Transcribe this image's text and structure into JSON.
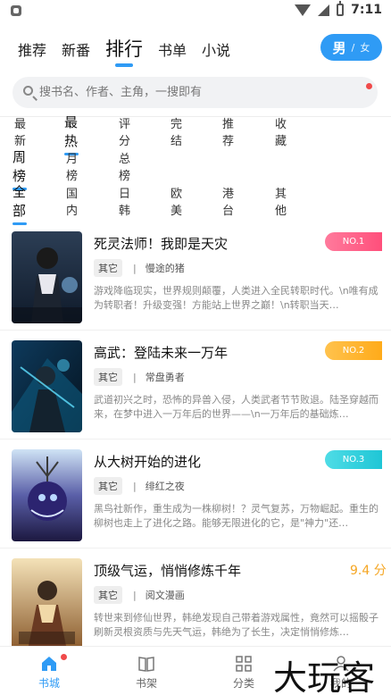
{
  "status_bar": {
    "time": "7:11"
  },
  "top_tabs": [
    {
      "label": "推荐",
      "active": false
    },
    {
      "label": "新番",
      "active": false
    },
    {
      "label": "排行",
      "active": true
    },
    {
      "label": "书单",
      "active": false
    },
    {
      "label": "小说",
      "active": false
    }
  ],
  "gender_toggle": {
    "male": "男",
    "separator": "/",
    "female": "女",
    "selected": "男"
  },
  "search": {
    "placeholder": "搜书名、作者、主角，一搜即有"
  },
  "sort_filters": [
    {
      "label": "最新",
      "active": false
    },
    {
      "label": "最热",
      "active": true
    },
    {
      "label": "评分",
      "active": false
    },
    {
      "label": "完结",
      "active": false
    },
    {
      "label": "推荐",
      "active": false
    },
    {
      "label": "收藏",
      "active": false
    }
  ],
  "period_filters": [
    {
      "label": "周榜",
      "active": true
    },
    {
      "label": "月榜",
      "active": false
    },
    {
      "label": "总榜",
      "active": false
    }
  ],
  "region_filters": [
    {
      "label": "全部",
      "active": true
    },
    {
      "label": "国内",
      "active": false
    },
    {
      "label": "日韩",
      "active": false
    },
    {
      "label": "欧美",
      "active": false
    },
    {
      "label": "港台",
      "active": false
    },
    {
      "label": "其他",
      "active": false
    }
  ],
  "books": [
    {
      "title": "死灵法师！我即是天灾",
      "tag": "其它",
      "separator": "|",
      "author": "慢途的猪",
      "description": "游戏降临现实，世界规则颠覆，人类进入全民转职时代。\\n唯有成为转职者！升级变强！方能站上世界之巅！\\n转职当天…",
      "rank": "NO.1",
      "rank_color": "#ff4f7b"
    },
    {
      "title": "高武：登陆未来一万年",
      "tag": "其它",
      "separator": "|",
      "author": "常盘勇者",
      "description": "武道初兴之时，恐怖的异兽入侵，人类武者节节败退。陆圣穿越而来，在梦中进入一万年后的世界——\\n一万年后的基础炼…",
      "rank": "NO.2",
      "rank_color": "#ffab1a"
    },
    {
      "title": "从大树开始的进化",
      "tag": "其它",
      "separator": "|",
      "author": "绯红之夜",
      "description": "黑鸟社新作，重生成为一株柳树！？灵气复苏，万物崛起。重生的柳树也走上了进化之路。能够无限进化的它，是\"神力\"还…",
      "rank": "NO.3",
      "rank_color": "#1fc6d6"
    },
    {
      "title": "顶级气运，悄悄修炼千年",
      "tag": "其它",
      "separator": "|",
      "author": "阅文漫画",
      "description": "转世来到修仙世界，韩绝发现自己带着游戏属性，竟然可以摇骰子刷新灵根资质与先天气运，韩绝为了长生，决定悄悄修炼…",
      "score": "9.4 分"
    }
  ],
  "bottom_nav": [
    {
      "label": "书城",
      "icon": "home-icon",
      "active": true
    },
    {
      "label": "书架",
      "icon": "book-icon",
      "active": false
    },
    {
      "label": "分类",
      "icon": "grid-icon",
      "active": false
    },
    {
      "label": "我的",
      "icon": "user-icon",
      "active": false
    }
  ],
  "watermark": "大玩客",
  "colors": {
    "accent": "#2f9bf5",
    "dot": "#f04a4a",
    "score": "#f5a623"
  }
}
